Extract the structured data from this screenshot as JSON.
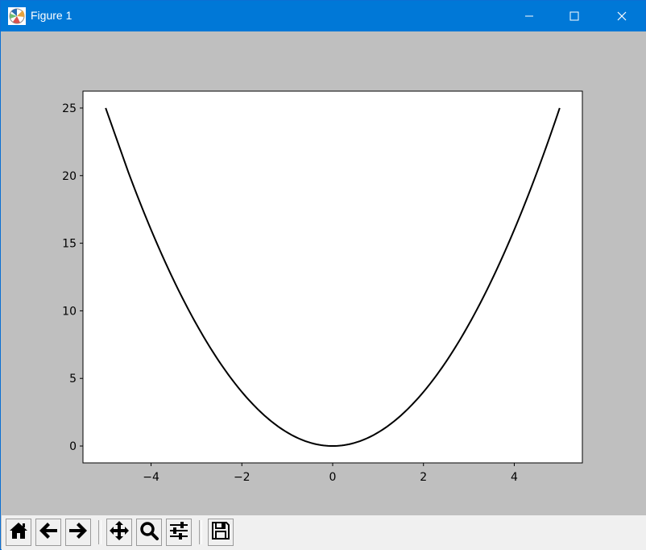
{
  "window": {
    "title": "Figure 1",
    "app_icon": "matplotlib-icon",
    "controls": {
      "minimize_icon": "minimize-icon",
      "maximize_icon": "maximize-icon",
      "close_icon": "close-icon"
    },
    "titlebar_color": "#0078d7"
  },
  "toolbar": {
    "buttons": [
      {
        "name": "home",
        "icon": "home-icon"
      },
      {
        "name": "back",
        "icon": "arrow-left-icon"
      },
      {
        "name": "forward",
        "icon": "arrow-right-icon"
      },
      {
        "name": "pan",
        "icon": "move-icon"
      },
      {
        "name": "zoom",
        "icon": "magnifier-icon"
      },
      {
        "name": "configure-subplots",
        "icon": "sliders-icon"
      },
      {
        "name": "save",
        "icon": "floppy-disk-icon"
      }
    ]
  },
  "chart_data": {
    "type": "line",
    "title": "",
    "xlabel": "",
    "ylabel": "",
    "xlim": [
      -5.5,
      5.5
    ],
    "ylim": [
      -1.25,
      26.25
    ],
    "x_ticks": [
      -4,
      -2,
      0,
      2,
      4
    ],
    "x_tick_labels": [
      "−4",
      "−2",
      "0",
      "2",
      "4"
    ],
    "y_ticks": [
      0,
      5,
      10,
      15,
      20,
      25
    ],
    "y_tick_labels": [
      "0",
      "5",
      "10",
      "15",
      "20",
      "25"
    ],
    "grid": false,
    "legend": "none",
    "series": [
      {
        "color": "#000000",
        "x": [
          -5,
          -4.5,
          -4,
          -3.5,
          -3,
          -2.5,
          -2,
          -1.5,
          -1,
          -0.5,
          0,
          0.5,
          1,
          1.5,
          2,
          2.5,
          3,
          3.5,
          4,
          4.5,
          5
        ],
        "y": [
          25,
          20.25,
          16,
          12.25,
          9,
          6.25,
          4,
          2.25,
          1,
          0.25,
          0,
          0.25,
          1,
          2.25,
          4,
          6.25,
          9,
          12.25,
          16,
          20.25,
          25
        ]
      }
    ],
    "background": "#ffffff",
    "figure_background": "#bfbfbf"
  }
}
